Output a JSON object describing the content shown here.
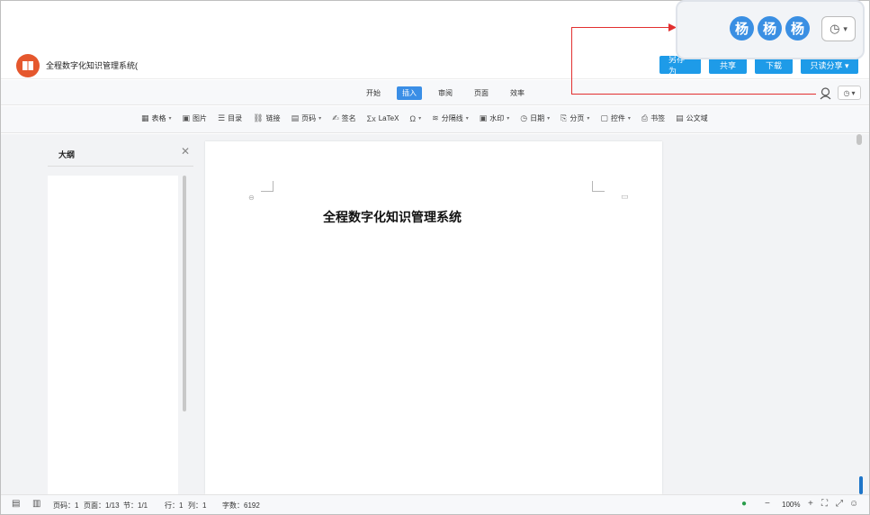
{
  "header": {
    "title": "全程数字化知识管理系统(",
    "buttons": [
      "另存为",
      "共享",
      "下载",
      "只读分享 ▾"
    ]
  },
  "menubar": {
    "tabs": [
      "开始",
      "插入",
      "审阅",
      "页面",
      "效率"
    ],
    "active_tab": "插入"
  },
  "toolbar": {
    "items": [
      {
        "icon": "table-icon",
        "glyph": "▦",
        "label": "表格",
        "caret": true
      },
      {
        "icon": "image-icon",
        "glyph": "▣",
        "label": "图片",
        "caret": false
      },
      {
        "icon": "toc-icon",
        "glyph": "☰",
        "label": "目录",
        "caret": false
      },
      {
        "icon": "link-icon",
        "glyph": "⛓",
        "label": "链接",
        "caret": false
      },
      {
        "icon": "page-number-icon",
        "glyph": "▤",
        "label": "页码",
        "caret": true
      },
      {
        "icon": "signature-icon",
        "glyph": "✍",
        "label": "签名",
        "caret": false
      },
      {
        "icon": "latex-icon",
        "glyph": "Σx",
        "label": "LaTeX",
        "caret": false
      },
      {
        "icon": "symbol-icon",
        "glyph": "Ω",
        "label": "",
        "caret": true
      },
      {
        "icon": "divider-icon",
        "glyph": "≋",
        "label": "分隔线",
        "caret": true
      },
      {
        "icon": "watermark-icon",
        "glyph": "▣",
        "label": "水印",
        "caret": true
      },
      {
        "icon": "date-icon",
        "glyph": "◷",
        "label": "日期",
        "caret": true
      },
      {
        "icon": "page-break-icon",
        "glyph": "⎘",
        "label": "分页",
        "caret": true
      },
      {
        "icon": "control-icon",
        "glyph": "▢",
        "label": "控件",
        "caret": true
      },
      {
        "icon": "bookmark-icon",
        "glyph": "⎙",
        "label": "书签",
        "caret": false
      },
      {
        "icon": "document-field-icon",
        "glyph": "▤",
        "label": "公文域",
        "caret": false
      }
    ]
  },
  "outline": {
    "title": "大纲"
  },
  "document": {
    "heading": "全程数字化知识管理系统"
  },
  "statusbar": {
    "page_number": "页码：1",
    "pages": "页面：1/13",
    "section": "节：1/1",
    "row": "行：1",
    "column": "列：1",
    "word_count": "字数：6192",
    "zoom": "100%"
  },
  "callout": {
    "avatars": [
      "杨",
      "杨",
      "杨"
    ],
    "history_icon": "history-icon"
  },
  "colors": {
    "accent": "#1e9be8",
    "logo": "#e5572d",
    "avatar": "#3a8fe3",
    "pointer_line": "#e23030"
  }
}
